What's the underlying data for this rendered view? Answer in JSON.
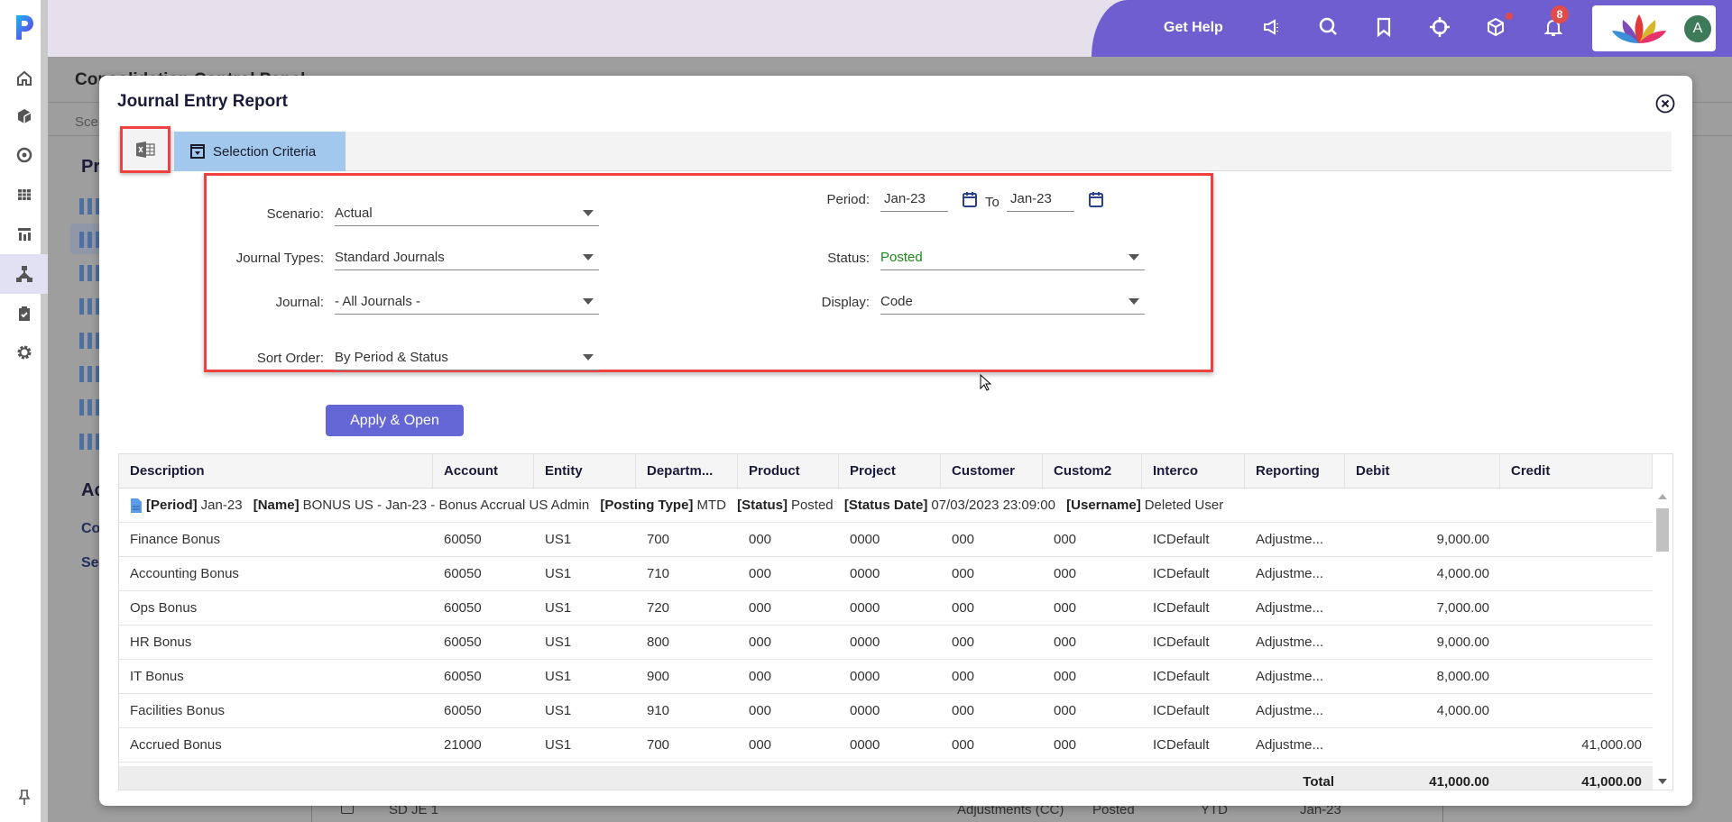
{
  "app": {
    "logo_letter": "P",
    "accent": "#6f5ecf"
  },
  "sidebar": {
    "items": [
      {
        "icon": "home-icon"
      },
      {
        "icon": "cube-icon"
      },
      {
        "icon": "target-icon"
      },
      {
        "icon": "grid-icon"
      },
      {
        "icon": "report-icon"
      },
      {
        "icon": "hierarchy-icon",
        "active": true
      },
      {
        "icon": "clipboard-check-icon"
      },
      {
        "icon": "gear-icon"
      }
    ],
    "pin_icon": "pin-icon"
  },
  "topbar": {
    "get_help": "Get Help",
    "notification_count": "8",
    "avatar_initial": "A"
  },
  "background": {
    "page_title": "Consolidation Control Panel",
    "scenario_label": "Sce",
    "section1": "Pr",
    "section2": "Ac",
    "link1": "Co",
    "link2": "Se",
    "row": {
      "name": "SD JE 1",
      "type": "Adjustments (CC)",
      "status": "Posted",
      "posting": "YTD",
      "period": "Jan-23"
    }
  },
  "modal": {
    "title": "Journal Entry Report",
    "toolbar": {
      "excel_icon": "excel-export-icon",
      "selection_tab": "Selection Criteria"
    },
    "form": {
      "scenario": {
        "label": "Scenario:",
        "value": "Actual"
      },
      "journal_types": {
        "label": "Journal Types:",
        "value": "Standard Journals"
      },
      "journal": {
        "label": "Journal:",
        "value": "- All Journals -"
      },
      "sort_order": {
        "label": "Sort Order:",
        "value": "By Period & Status"
      },
      "period": {
        "label": "Period:",
        "from": "Jan-23",
        "to_label": "To",
        "to": "Jan-23"
      },
      "status": {
        "label": "Status:",
        "value": "Posted",
        "color": "#1a8a1a"
      },
      "display": {
        "label": "Display:",
        "value": "Code"
      }
    },
    "apply_button": "Apply & Open",
    "table": {
      "columns": [
        "Description",
        "Account",
        "Entity",
        "Departm...",
        "Product",
        "Project",
        "Customer",
        "Custom2",
        "Interco",
        "Reporting",
        "Debit",
        "Credit"
      ],
      "group": {
        "period_label": "[Period]",
        "period": "Jan-23",
        "name_label": "[Name]",
        "name": "BONUS US - Jan-23 - Bonus Accrual US Admin",
        "posting_label": "[Posting Type]",
        "posting": "MTD",
        "status_label": "[Status]",
        "status": "Posted",
        "date_label": "[Status Date]",
        "date": "07/03/2023 23:09:00",
        "user_label": "[Username]",
        "user": "Deleted User"
      },
      "rows": [
        [
          "Finance Bonus",
          "60050",
          "US1",
          "700",
          "000",
          "0000",
          "000",
          "000",
          "ICDefault",
          "Adjustme...",
          "9,000.00",
          ""
        ],
        [
          "Accounting Bonus",
          "60050",
          "US1",
          "710",
          "000",
          "0000",
          "000",
          "000",
          "ICDefault",
          "Adjustme...",
          "4,000.00",
          ""
        ],
        [
          "Ops Bonus",
          "60050",
          "US1",
          "720",
          "000",
          "0000",
          "000",
          "000",
          "ICDefault",
          "Adjustme...",
          "7,000.00",
          ""
        ],
        [
          "HR Bonus",
          "60050",
          "US1",
          "800",
          "000",
          "0000",
          "000",
          "000",
          "ICDefault",
          "Adjustme...",
          "9,000.00",
          ""
        ],
        [
          "IT Bonus",
          "60050",
          "US1",
          "900",
          "000",
          "0000",
          "000",
          "000",
          "ICDefault",
          "Adjustme...",
          "8,000.00",
          ""
        ],
        [
          "Facilities Bonus",
          "60050",
          "US1",
          "910",
          "000",
          "0000",
          "000",
          "000",
          "ICDefault",
          "Adjustme...",
          "4,000.00",
          ""
        ],
        [
          "Accrued Bonus",
          "21000",
          "US1",
          "700",
          "000",
          "0000",
          "000",
          "000",
          "ICDefault",
          "Adjustme...",
          "",
          "41,000.00"
        ]
      ],
      "total": {
        "label": "Total",
        "debit": "41,000.00",
        "credit": "41,000.00"
      }
    }
  }
}
